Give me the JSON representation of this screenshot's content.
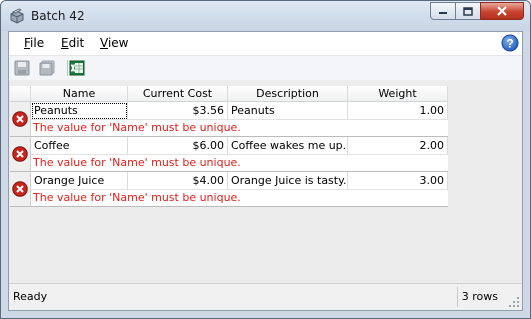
{
  "window": {
    "title": "Batch 42"
  },
  "menu": [
    {
      "label": "File",
      "accel": "F",
      "rest": "ile"
    },
    {
      "label": "Edit",
      "accel": "E",
      "rest": "dit"
    },
    {
      "label": "View",
      "accel": "V",
      "rest": "iew"
    }
  ],
  "toolbar": {
    "buttons": [
      {
        "name": "save-icon",
        "enabled": false
      },
      {
        "name": "save-all-icon",
        "enabled": false
      },
      {
        "name": "excel-export-icon",
        "enabled": true
      }
    ]
  },
  "grid": {
    "columns": [
      "Name",
      "Current Cost",
      "Description",
      "Weight"
    ],
    "rows": [
      {
        "name": "Peanuts",
        "cost": "$3.56",
        "description": "Peanuts",
        "weight": "1.00",
        "error": "The value for 'Name' must be unique."
      },
      {
        "name": "Coffee",
        "cost": "$6.00",
        "description": "Coffee wakes me up.",
        "weight": "2.00",
        "error": "The value for 'Name' must be unique."
      },
      {
        "name": "Orange Juice",
        "cost": "$4.00",
        "description": "Orange Juice is tasty.",
        "weight": "3.00",
        "error": "The value for 'Name' must be unique."
      }
    ]
  },
  "status": {
    "left": "Ready",
    "right": "3 rows"
  },
  "colors": {
    "error_text": "#e0201a",
    "error_icon": "#c8261c"
  }
}
